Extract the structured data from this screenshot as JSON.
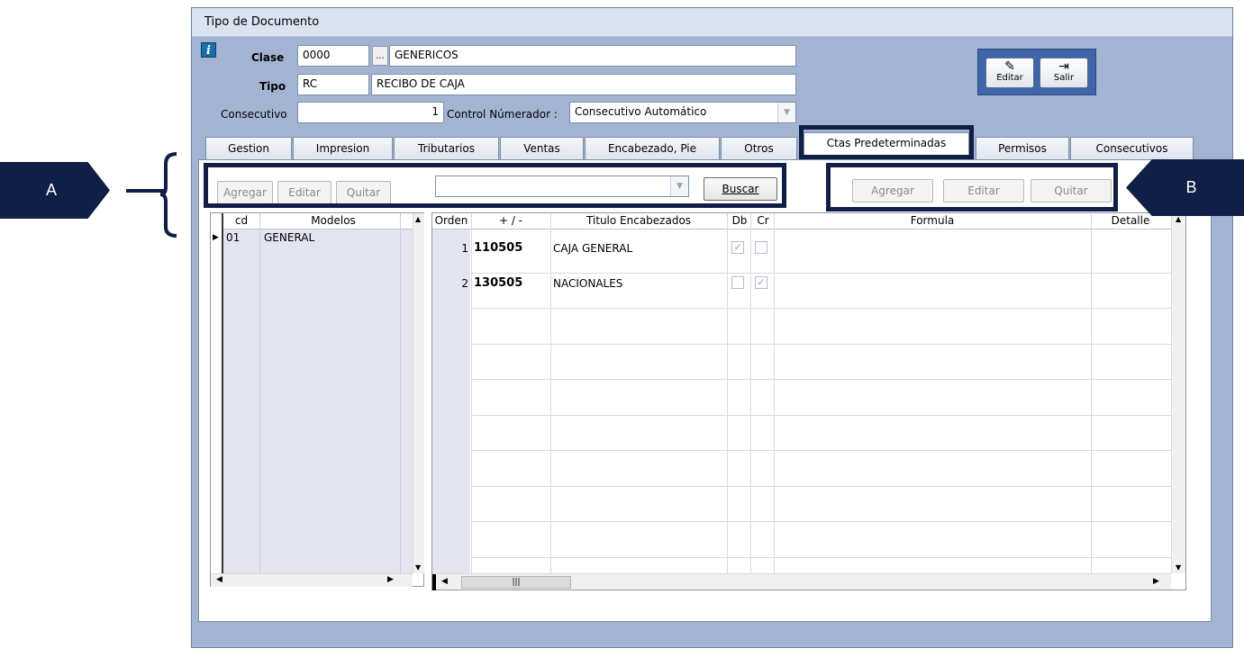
{
  "window": {
    "title": "Tipo de Documento"
  },
  "form": {
    "clase_label": "Clase",
    "clase_code": "0000",
    "clase_browse": "...",
    "clase_name": "GENERICOS",
    "tipo_label": "Tipo",
    "tipo_code": "RC",
    "tipo_name": "RECIBO DE CAJA",
    "consecutivo_label": "Consecutivo",
    "consecutivo_value": "1",
    "control_label": "Control Númerador :",
    "control_value": "Consecutivo Automático"
  },
  "toolbar": {
    "edit_label": "Editar",
    "exit_label": "Salir"
  },
  "tabs": [
    {
      "label": "Gestion"
    },
    {
      "label": "Impresion"
    },
    {
      "label": "Tributarios"
    },
    {
      "label": "Ventas"
    },
    {
      "label": "Encabezado, Pie"
    },
    {
      "label": "Otros"
    },
    {
      "label": "Ctas Predeterminadas"
    },
    {
      "label": "Permisos"
    },
    {
      "label": "Consecutivos"
    }
  ],
  "left_panel": {
    "buttons": {
      "add": "Agregar",
      "edit": "Editar",
      "remove": "Quitar",
      "search": "Buscar"
    },
    "search_value": "",
    "columns": {
      "cd": "cd",
      "modelos": "Modelos"
    },
    "rows": [
      {
        "cd": "01",
        "modelo": "GENERAL"
      }
    ]
  },
  "right_panel": {
    "buttons": {
      "add": "Agregar",
      "edit": "Editar",
      "remove": "Quitar"
    },
    "columns": {
      "orden": "Orden",
      "sign": "+ / -",
      "titulo": "Titulo Encabezados",
      "db": "Db",
      "cr": "Cr",
      "formula": "Formula",
      "detalle": "Detalle"
    },
    "rows": [
      {
        "orden": "1",
        "cuenta": "110505",
        "titulo": "CAJA GENERAL",
        "db": true,
        "cr": false
      },
      {
        "orden": "2",
        "cuenta": "130505",
        "titulo": "NACIONALES",
        "db": false,
        "cr": true
      }
    ]
  },
  "annotations": {
    "a": "A",
    "b": "B"
  },
  "colors": {
    "highlight": "#0f1f45",
    "window_bg": "#a3b4d3",
    "toolbar_bg": "#3f66a8"
  }
}
